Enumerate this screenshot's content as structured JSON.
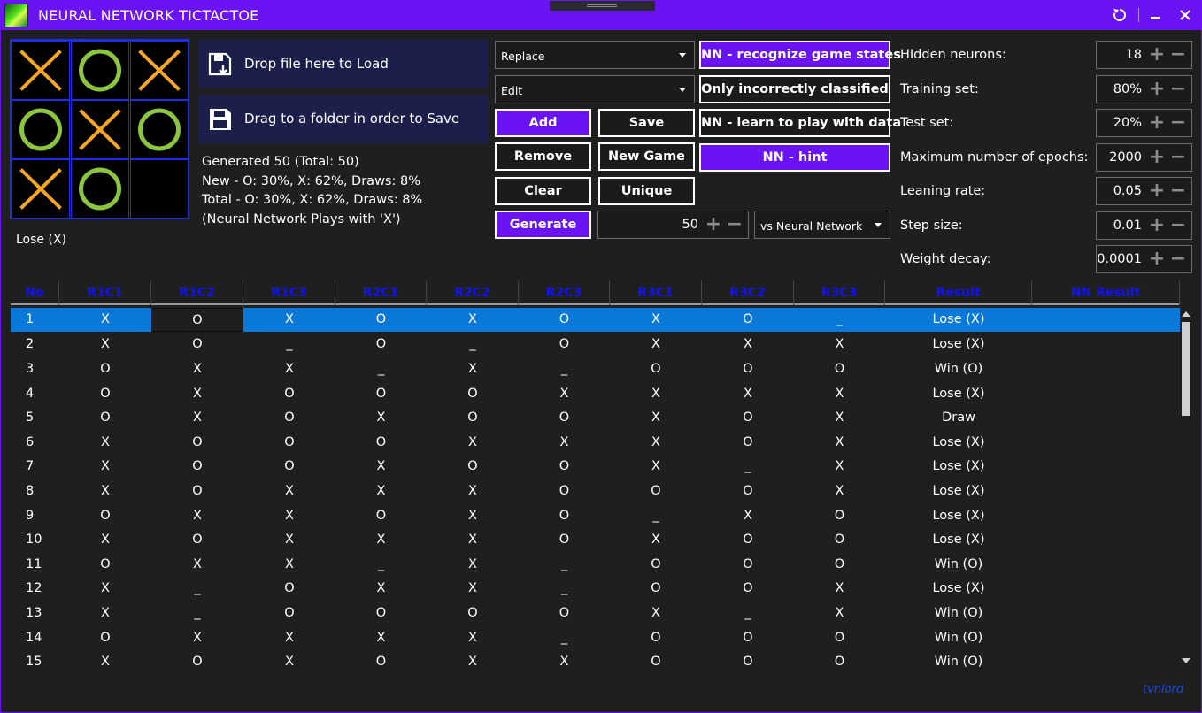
{
  "window": {
    "title": "NEURAL NETWORK TICTACTOE",
    "restore_icon": "refresh-icon",
    "minimize_icon": "minimize-icon",
    "close_icon": "close-icon"
  },
  "board": {
    "cells": [
      "X",
      "O",
      "X",
      "O",
      "X",
      "O",
      "X",
      "O",
      ""
    ],
    "x_color": "#f5a623",
    "o_color": "#8cc63f"
  },
  "status": "Lose (X)",
  "drop_panels": {
    "load_label": "Drop file here to Load",
    "save_label": "Drag to a folder in order to Save"
  },
  "info": {
    "generated": "Generated 50 (Total: 50)",
    "new_stats": "New - O: 30%, X: 62%, Draws: 8%",
    "total_stats": "Total - O: 30%, X: 62%, Draws: 8%",
    "plays_with": "(Neural Network Plays with 'X')"
  },
  "controls": {
    "replace_dropdown": "Replace",
    "edit_dropdown": "Edit",
    "add": "Add",
    "save": "Save",
    "remove": "Remove",
    "new_game": "New Game",
    "clear": "Clear",
    "unique": "Unique",
    "generate": "Generate",
    "generate_count": "50",
    "opponent_dropdown": "vs Neural Network",
    "nn_recognize": "NN - recognize game states",
    "only_incorrect": "Only incorrectly classified",
    "nn_learn": "NN - learn to play with data",
    "nn_hint": "NN - hint"
  },
  "params": [
    {
      "label": "HIdden neurons:",
      "value": "18"
    },
    {
      "label": "Training set:",
      "value": "80%"
    },
    {
      "label": "Test set:",
      "value": "20%"
    },
    {
      "label": "Maximum number of epochs:",
      "value": "2000"
    },
    {
      "label": "Leaning rate:",
      "value": "0.05"
    },
    {
      "label": "Step size:",
      "value": "0.01"
    },
    {
      "label": "Weight decay:",
      "value": "0.0001"
    }
  ],
  "table": {
    "headers": [
      "No",
      "R1C1",
      "R1C2",
      "R1C3",
      "R2C1",
      "R2C2",
      "R2C3",
      "R3C1",
      "R3C2",
      "R3C3",
      "Result",
      "NN Result"
    ],
    "rows": [
      [
        "1",
        "X",
        "O",
        "X",
        "O",
        "X",
        "O",
        "X",
        "O",
        "_",
        "Lose (X)",
        ""
      ],
      [
        "2",
        "X",
        "O",
        "_",
        "O",
        "_",
        "O",
        "X",
        "X",
        "X",
        "Lose (X)",
        ""
      ],
      [
        "3",
        "O",
        "X",
        "X",
        "_",
        "X",
        "_",
        "O",
        "O",
        "O",
        "Win (O)",
        ""
      ],
      [
        "4",
        "O",
        "X",
        "O",
        "O",
        "O",
        "X",
        "X",
        "X",
        "X",
        "Lose (X)",
        ""
      ],
      [
        "5",
        "O",
        "X",
        "O",
        "X",
        "O",
        "O",
        "X",
        "O",
        "X",
        "Draw",
        ""
      ],
      [
        "6",
        "X",
        "O",
        "O",
        "O",
        "X",
        "X",
        "X",
        "O",
        "X",
        "Lose (X)",
        ""
      ],
      [
        "7",
        "X",
        "O",
        "O",
        "X",
        "O",
        "O",
        "X",
        "_",
        "X",
        "Lose (X)",
        ""
      ],
      [
        "8",
        "X",
        "O",
        "X",
        "X",
        "X",
        "O",
        "O",
        "O",
        "X",
        "Lose (X)",
        ""
      ],
      [
        "9",
        "O",
        "X",
        "X",
        "O",
        "X",
        "O",
        "_",
        "X",
        "O",
        "Lose (X)",
        ""
      ],
      [
        "10",
        "X",
        "O",
        "X",
        "X",
        "X",
        "O",
        "X",
        "O",
        "O",
        "Lose (X)",
        ""
      ],
      [
        "11",
        "O",
        "X",
        "X",
        "_",
        "X",
        "_",
        "O",
        "O",
        "O",
        "Win (O)",
        ""
      ],
      [
        "12",
        "X",
        "_",
        "O",
        "X",
        "X",
        "_",
        "O",
        "O",
        "X",
        "Lose (X)",
        ""
      ],
      [
        "13",
        "X",
        "_",
        "O",
        "O",
        "O",
        "O",
        "X",
        "_",
        "X",
        "Win (O)",
        ""
      ],
      [
        "14",
        "O",
        "X",
        "X",
        "X",
        "X",
        "_",
        "O",
        "O",
        "O",
        "Win (O)",
        ""
      ],
      [
        "15",
        "X",
        "O",
        "X",
        "O",
        "X",
        "X",
        "O",
        "O",
        "O",
        "Win (O)",
        ""
      ]
    ]
  },
  "signature": "tvnlord"
}
